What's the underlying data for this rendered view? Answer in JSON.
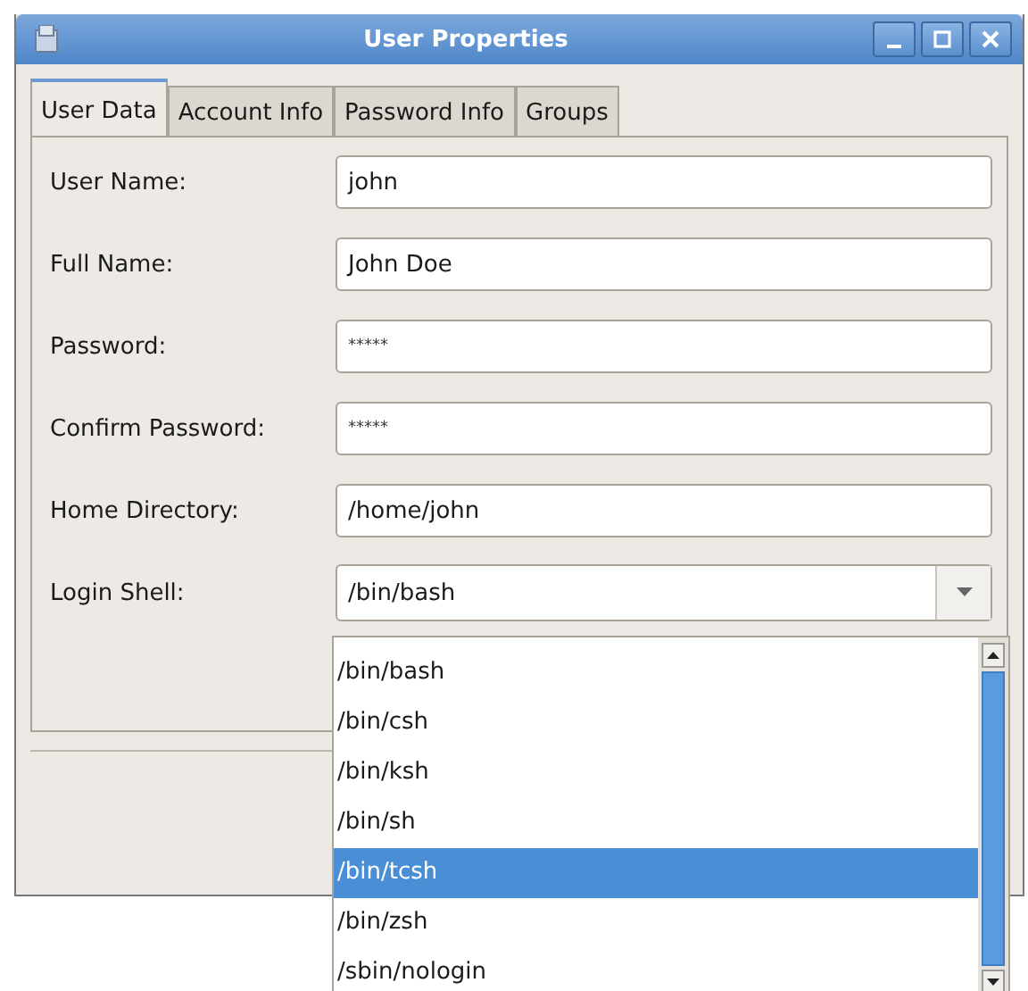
{
  "window": {
    "title": "User Properties"
  },
  "tabs": [
    {
      "label": "User Data",
      "selected": true
    },
    {
      "label": "Account Info",
      "selected": false
    },
    {
      "label": "Password Info",
      "selected": false
    },
    {
      "label": "Groups",
      "selected": false
    }
  ],
  "fields": [
    {
      "label": "User Name:",
      "value": "john",
      "kind": "text"
    },
    {
      "label": "Full Name:",
      "value": "John Doe",
      "kind": "text"
    },
    {
      "label": "Password:",
      "value": "*****",
      "kind": "password"
    },
    {
      "label": "Confirm Password:",
      "value": "*****",
      "kind": "password"
    },
    {
      "label": "Home Directory:",
      "value": "/home/john",
      "kind": "text"
    },
    {
      "label": "Login Shell:",
      "value": "/bin/bash",
      "kind": "combo"
    }
  ],
  "shell_list": [
    {
      "label": "/bin/bash",
      "selected": false
    },
    {
      "label": "/bin/csh",
      "selected": false
    },
    {
      "label": "/bin/ksh",
      "selected": false
    },
    {
      "label": "/bin/sh",
      "selected": false
    },
    {
      "label": "/bin/tcsh",
      "selected": true
    },
    {
      "label": "/bin/zsh",
      "selected": false
    },
    {
      "label": "/sbin/nologin",
      "selected": false
    }
  ]
}
